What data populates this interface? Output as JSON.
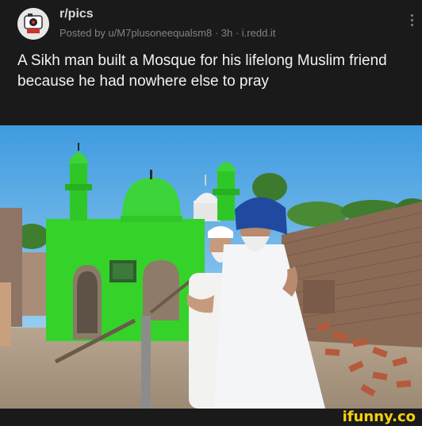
{
  "post": {
    "subreddit": "r/pics",
    "meta": "Posted by u/M7plusoneequalsm8 · 3h · i.redd.it",
    "title": "A Sikh man built a Mosque for his lifelong Muslim friend because he had nowhere else to pray"
  },
  "image": {
    "sign_text": "",
    "colors": {
      "sky": "#63b3e3",
      "mosque_green": "#35d22a",
      "dome_green": "#3dd33a",
      "brick": "#8a6a55",
      "turban": "#1f4aa0"
    }
  },
  "footer": {
    "watermark": "ifunny.co"
  },
  "icons": {
    "avatar": "subreddit-avatar-icon",
    "menu": "kebab-menu-icon"
  }
}
